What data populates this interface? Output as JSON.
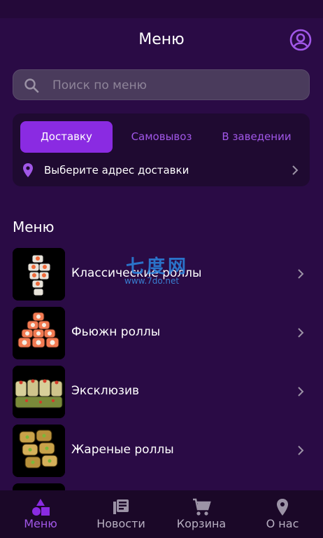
{
  "header": {
    "title": "Меню"
  },
  "search": {
    "placeholder": "Поиск по меню",
    "value": ""
  },
  "delivery": {
    "tabs": [
      {
        "label": "Доставку",
        "active": true
      },
      {
        "label": "Самовывоз",
        "active": false
      },
      {
        "label": "В заведении",
        "active": false
      }
    ],
    "address_prompt": "Выберите адрес доставки"
  },
  "menu": {
    "section_title": "Меню",
    "categories": [
      {
        "label": "Классические роллы",
        "icon": "classic-rolls-image"
      },
      {
        "label": "Фьюжн роллы",
        "icon": "fusion-rolls-image"
      },
      {
        "label": "Эксклюзив",
        "icon": "exclusive-rolls-image"
      },
      {
        "label": "Жареные роллы",
        "icon": "fried-rolls-image"
      }
    ]
  },
  "watermark": {
    "line1": "七度网",
    "line2": "www.7do.net"
  },
  "bottom_nav": {
    "items": [
      {
        "label": "Меню",
        "icon": "shapes-icon",
        "active": true
      },
      {
        "label": "Новости",
        "icon": "news-icon",
        "active": false
      },
      {
        "label": "Корзина",
        "icon": "cart-icon",
        "active": false
      },
      {
        "label": "О нас",
        "icon": "location-pin-icon",
        "active": false
      }
    ]
  },
  "colors": {
    "background": "#2a0b45",
    "accent": "#8a2be2",
    "accent_text": "#a157e8",
    "card": "#1f0a31",
    "search_bg": "#4a3b5c",
    "nav_bg": "#1b0828"
  }
}
